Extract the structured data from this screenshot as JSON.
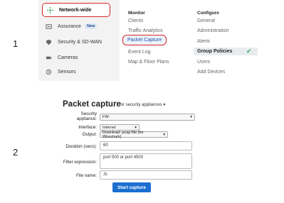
{
  "step_labels": {
    "one": "1",
    "two": "2"
  },
  "sidebar": {
    "items": [
      {
        "label": "Network-wide",
        "icon": "network-icon"
      },
      {
        "label": "Assurance",
        "icon": "assurance-icon",
        "badge": "New"
      },
      {
        "label": "Security & SD-WAN",
        "icon": "shield-icon"
      },
      {
        "label": "Cameras",
        "icon": "camera-icon"
      },
      {
        "label": "Sensors",
        "icon": "sensor-icon"
      }
    ]
  },
  "menu": {
    "monitor_header": "Monitor",
    "configure_header": "Configure",
    "monitor_items": [
      "Clients",
      "Traffic Analytics",
      "Packet Capture",
      "Event Log",
      "Map & Floor Plans"
    ],
    "configure_items": [
      "General",
      "Administration",
      "Alerts",
      "Group Policies",
      "Users",
      "Add Devices"
    ]
  },
  "packet_capture": {
    "title": "Packet capture",
    "subtitle": "for security appliances ▾",
    "security_appliance_label": "Security appliance:",
    "security_appliance_value": "FW-",
    "interface_label": "Interface:",
    "interface_value": "Internet",
    "output_label": "Output:",
    "output_value": "Download .pcap file (for Wireshark)",
    "duration_label": "Duration (secs):",
    "duration_value": "60",
    "filter_label": "Filter expression:",
    "filter_value": "port 500 or port 4500",
    "filename_label": "File name:",
    "filename_value": "Jc",
    "start_button": "Start capture"
  },
  "colors": {
    "accent_red": "#d62828",
    "button_blue": "#1b6fd1",
    "check_green": "#3aa655"
  }
}
